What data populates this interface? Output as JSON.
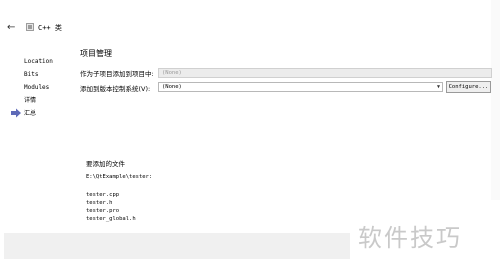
{
  "window": {
    "back_glyph": "←",
    "title": "C++ 类"
  },
  "sidebar": {
    "items": [
      {
        "label": "Location"
      },
      {
        "label": "Bits"
      },
      {
        "label": "Modules"
      },
      {
        "label": "详情"
      },
      {
        "label": "汇总"
      }
    ]
  },
  "main": {
    "title": "项目管理",
    "subproject": {
      "label": "作为子项目添加到项目中:",
      "value": "(None)"
    },
    "vcs": {
      "label": "添加到版本控制系统(V):",
      "value": "(None)",
      "configure_label": "Configure..."
    },
    "files": {
      "heading": "要添加的文件",
      "path": "E:\\QtExample\\tester:",
      "list": [
        "tester.cpp",
        "tester.h",
        "tester.pro",
        "tester_global.h"
      ]
    }
  },
  "watermark": "软件技巧",
  "colors": {
    "footer_bg": "#f0f0f0",
    "disabled_combo_bg": "#ececec",
    "arrow": "#5e6ab8"
  }
}
